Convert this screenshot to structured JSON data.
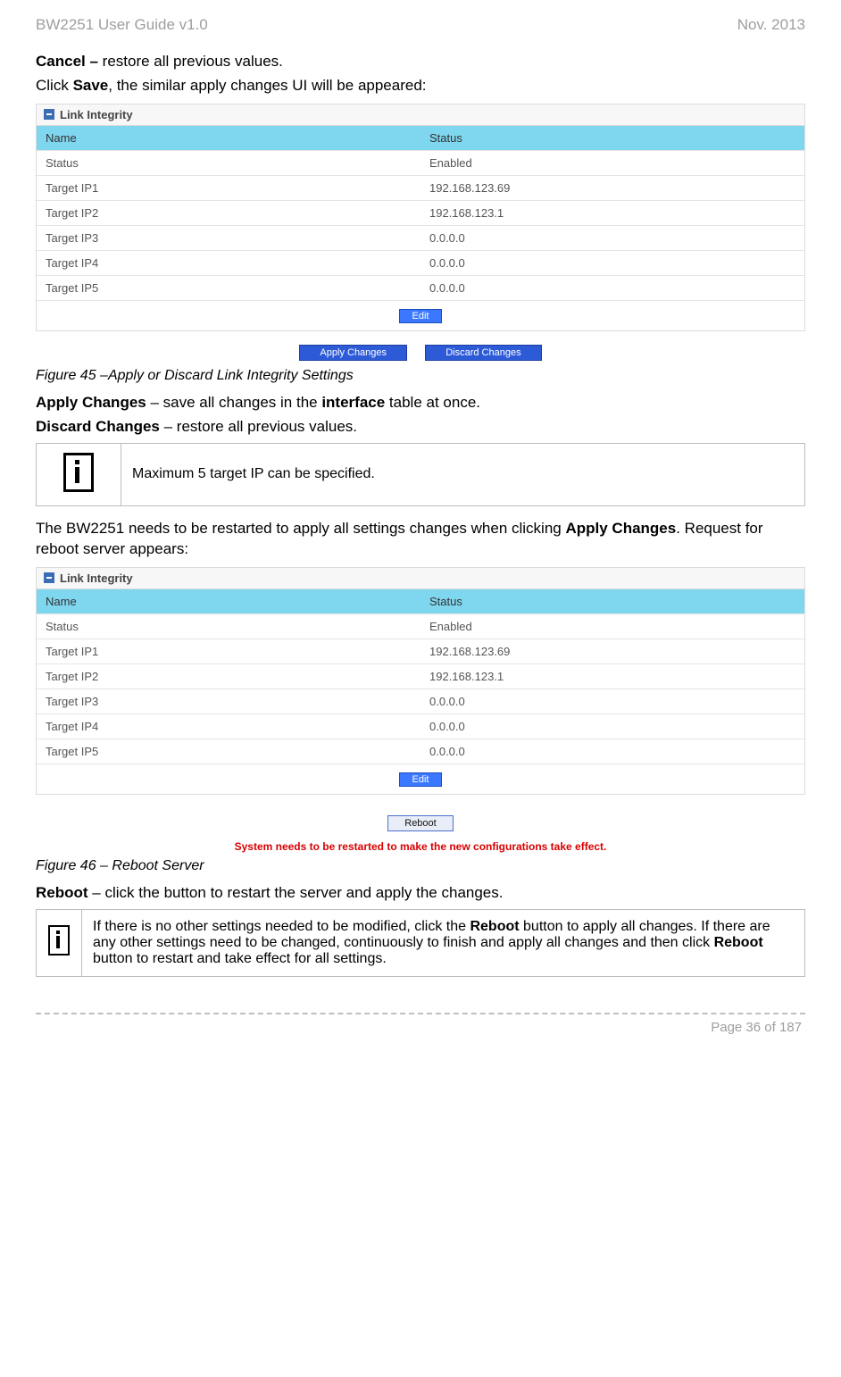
{
  "header": {
    "left": "BW2251 User Guide v1.0",
    "right": "Nov.  2013"
  },
  "intro": {
    "cancel_label": "Cancel –",
    "cancel_text": " restore all previous values.",
    "click_prefix": "Click ",
    "save_label": "Save",
    "click_suffix": ", the similar apply changes UI will be appeared:"
  },
  "panel1": {
    "title": "Link Integrity",
    "col1": "Name",
    "col2": "Status",
    "rows": [
      {
        "k": "Status",
        "v": "Enabled"
      },
      {
        "k": "Target IP1",
        "v": "192.168.123.69"
      },
      {
        "k": "Target IP2",
        "v": "192.168.123.1"
      },
      {
        "k": "Target IP3",
        "v": "0.0.0.0"
      },
      {
        "k": "Target IP4",
        "v": "0.0.0.0"
      },
      {
        "k": "Target IP5",
        "v": "0.0.0.0"
      }
    ],
    "edit": "Edit"
  },
  "apply_bar": {
    "apply": "Apply Changes",
    "discard": "Discard Changes"
  },
  "figure45": "Figure 45 –Apply or Discard Link Integrity Settings",
  "apply_desc": {
    "label": "Apply Changes",
    "mid": " – save all changes in the ",
    "iface": "interface",
    "end": " table at once."
  },
  "discard_desc": {
    "label": "Discard Changes",
    "text": " – restore all previous values."
  },
  "note1": "Maximum 5 target IP can be specified.",
  "restart_para": {
    "pre": "The BW2251 needs to be restarted to apply all settings changes when clicking ",
    "bold": "Apply Changes",
    "post1": ". Request for reboot server appears:"
  },
  "panel2": {
    "title": "Link Integrity",
    "col1": "Name",
    "col2": "Status",
    "rows": [
      {
        "k": "Status",
        "v": "Enabled"
      },
      {
        "k": "Target IP1",
        "v": "192.168.123.69"
      },
      {
        "k": "Target IP2",
        "v": "192.168.123.1"
      },
      {
        "k": "Target IP3",
        "v": "0.0.0.0"
      },
      {
        "k": "Target IP4",
        "v": "0.0.0.0"
      },
      {
        "k": "Target IP5",
        "v": "0.0.0.0"
      }
    ],
    "edit": "Edit"
  },
  "reboot_btn": "Reboot",
  "restart_note": "System needs to be restarted to make the new configurations take effect.",
  "figure46": "Figure 46 – Reboot Server",
  "reboot_desc": {
    "label": "Reboot",
    "text": " – click the button to restart the server and apply the changes."
  },
  "note2": {
    "p1": "If there is no other settings needed to be modified, click the ",
    "b1": "Reboot",
    "p2": " button to apply all changes. If there are any other settings need to be changed, continuously to finish and apply all changes and then click ",
    "b2": "Reboot",
    "p3": " button to restart and take effect  for all settings."
  },
  "footer": "Page 36 of 187"
}
